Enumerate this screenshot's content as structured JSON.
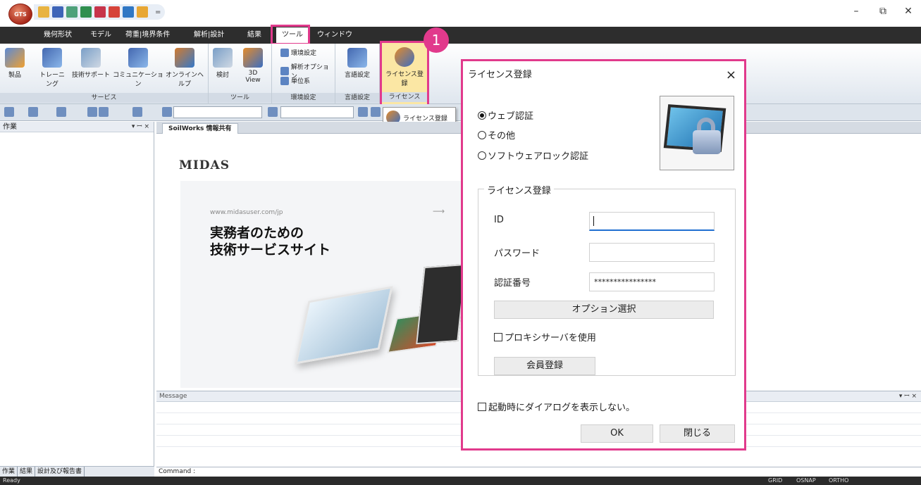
{
  "ribbon": {
    "tabs": [
      "幾何形状",
      "モデル",
      "荷重|境界条件",
      "解析|設計",
      "結果",
      "ツール",
      "ウィンドウ"
    ],
    "active_tab": "ツール",
    "groups": {
      "service": {
        "label": "サービス",
        "buttons": [
          "製品",
          "トレーニング",
          "技術サポート",
          "コミュニケーション",
          "オンラインヘルプ"
        ]
      },
      "tools": {
        "label": "ツール",
        "buttons": [
          "検討",
          "3D\nView"
        ]
      },
      "env": {
        "label": "環境設定",
        "items": [
          "環境設定",
          "解析オプション",
          "単位系"
        ]
      },
      "lang": {
        "label": "言語設定",
        "button": "言語設定"
      },
      "license": {
        "label": "ライセンス",
        "button": "ライセンス登録"
      }
    },
    "step_badge": "1"
  },
  "tooltip": {
    "text": "ライセンス登録"
  },
  "work_panel": {
    "title": "作業",
    "controls": "▾ ꟷ ×",
    "bottom_tabs": [
      "作業",
      "結果",
      "設計及び報告書"
    ]
  },
  "document": {
    "tab": "SoilWorks 情報共有",
    "logo": "MIDAS",
    "url": "www.midasuser.com/jp",
    "headline1": "実務者のための",
    "headline2": "技術サービスサイト"
  },
  "message_panel": {
    "title": "Message",
    "command_label": "Command :"
  },
  "statusbar": {
    "left": "Ready",
    "items": [
      "GRID",
      "OSNAP",
      "ORTHO"
    ]
  },
  "dialog": {
    "title": "ライセンス登録",
    "close": "×",
    "radios": [
      {
        "label": "ウェブ認証",
        "selected": true
      },
      {
        "label": "その他",
        "selected": false
      },
      {
        "label": "ソフトウェアロック認証",
        "selected": false
      }
    ],
    "group_title": "ライセンス登録",
    "fields": {
      "id_label": "ID",
      "id_value": "",
      "password_label": "パスワード",
      "password_value": "",
      "auth_label": "認証番号",
      "auth_value": "****************"
    },
    "option_button": "オプション選択",
    "proxy_checkbox": "プロキシサーバを使用",
    "member_button": "会員登録",
    "startup_checkbox": "起動時にダイアログを表示しない。",
    "ok_button": "OK",
    "close_button": "閉じる"
  },
  "window_controls": {
    "minimize": "–",
    "restore": "⧉",
    "close": "✕"
  },
  "colors": {
    "highlight": "#e13a8c",
    "tabbar": "#2d2d2d",
    "focus_blue": "#1f6fd1"
  }
}
